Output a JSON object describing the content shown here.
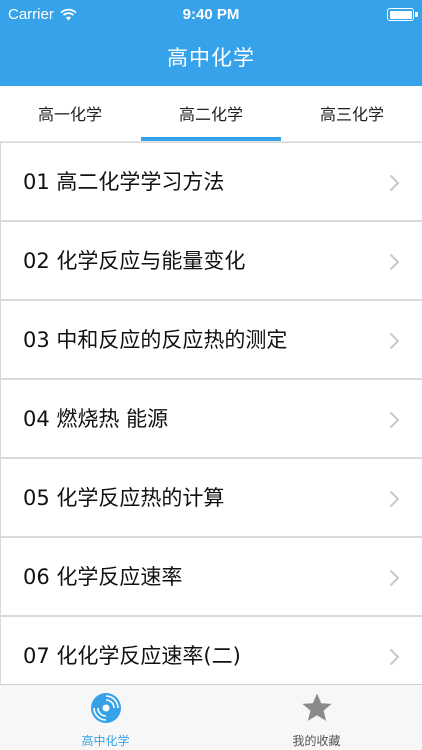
{
  "status_bar": {
    "carrier": "Carrier",
    "time": "9:40 PM",
    "wifi_icon": "wifi-icon",
    "battery_icon": "battery-icon"
  },
  "nav": {
    "title": "高中化学"
  },
  "tabs": [
    {
      "label": "高一化学",
      "selected": false
    },
    {
      "label": "高二化学",
      "selected": true
    },
    {
      "label": "高三化学",
      "selected": false
    }
  ],
  "list": {
    "items": [
      {
        "label": "01 高二化学学习方法"
      },
      {
        "label": "02 化学反应与能量变化"
      },
      {
        "label": "03 中和反应的反应热的测定"
      },
      {
        "label": "04 燃烧热 能源"
      },
      {
        "label": "05 化学反应热的计算"
      },
      {
        "label": "06 化学反应速率"
      },
      {
        "label": "07 化化学反应速率(二)"
      }
    ],
    "chevron_icon": "chevron-right-icon"
  },
  "tabbar": {
    "items": [
      {
        "label": "高中化学",
        "icon": "disc-icon",
        "active": true
      },
      {
        "label": "我的收藏",
        "icon": "star-icon",
        "active": false
      }
    ]
  },
  "colors": {
    "accent": "#36a2ea",
    "inactive": "#8a8a8a"
  }
}
